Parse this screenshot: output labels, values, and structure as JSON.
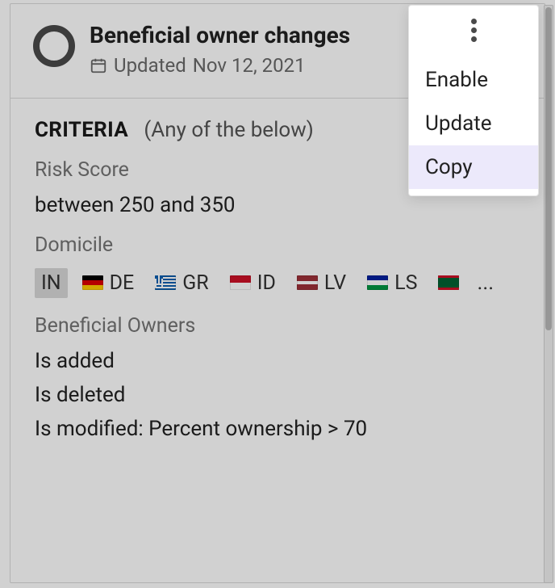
{
  "header": {
    "title": "Beneficial owner changes",
    "updated_prefix": "Updated",
    "updated_date": "Nov 12, 2021"
  },
  "criteria": {
    "label": "CRITERIA",
    "qualifier": "(Any of the below)"
  },
  "risk_score": {
    "label": "Risk Score",
    "value": "between 250 and 350"
  },
  "domicile": {
    "label": "Domicile",
    "items": [
      {
        "code": "IN",
        "flag": "",
        "highlighted": true
      },
      {
        "code": "DE",
        "flag": "de",
        "highlighted": false
      },
      {
        "code": "GR",
        "flag": "gr",
        "highlighted": false
      },
      {
        "code": "ID",
        "flag": "id",
        "highlighted": false
      },
      {
        "code": "LV",
        "flag": "lv",
        "highlighted": false
      },
      {
        "code": "LS",
        "flag": "ls",
        "highlighted": false
      },
      {
        "code": "",
        "flag": "mr",
        "highlighted": false
      }
    ],
    "overflow": "..."
  },
  "beneficial_owners": {
    "label": "Beneficial Owners",
    "conditions": [
      "Is added",
      "Is deleted",
      "Is modified: Percent ownership > 70"
    ]
  },
  "menu": {
    "items": [
      {
        "label": "Enable",
        "hover": false
      },
      {
        "label": "Update",
        "hover": false
      },
      {
        "label": "Copy",
        "hover": true
      }
    ]
  }
}
